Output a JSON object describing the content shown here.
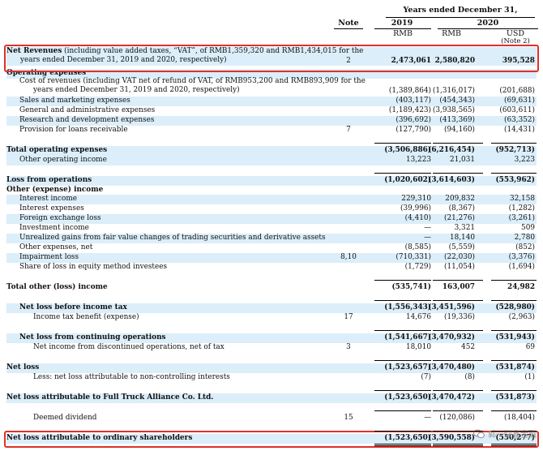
{
  "header": {
    "years_ended": "Years ended December 31,",
    "note": "Note",
    "y2019": "2019",
    "y2020": "2020",
    "rmb1": "RMB",
    "rmb2": "RMB",
    "usd": "USD",
    "note2": "(Note 2)"
  },
  "rows": [
    {
      "label": "Net Revenues (including value added taxes, “VAT”, of RMB1,359,320 and RMB1,434,015 for the",
      "label2": "years ended December 31, 2019 and 2020, respectively)",
      "indent": 0,
      "bold": false,
      "boldlead": "Net Revenues",
      "note": "2",
      "v2019": "2,473,061",
      "v2020": "2,580,820",
      "usd": "395,528",
      "bvals": true,
      "shade": true
    },
    {
      "label": "Operating expenses",
      "indent": 0,
      "bold": true,
      "shade": true
    },
    {
      "label": "Cost of revenues (including VAT net of refund of VAT, of RMB953,200 and RMB893,909 for the",
      "label2": "years ended December 31, 2019 and 2020, respectively)",
      "indent": 1,
      "bold": false,
      "v2019": "(1,389,864)",
      "v2020": "(1,316,017)",
      "usd": "(201,688)",
      "shade": false
    },
    {
      "label": "Sales and marketing expenses",
      "indent": 1,
      "v2019": "(403,117)",
      "v2020": "(454,343)",
      "usd": "(69,631)",
      "shade": true
    },
    {
      "label": "General and administrative expenses",
      "indent": 1,
      "v2019": "(1,189,423)",
      "v2020": "(3,938,565)",
      "usd": "(603,611)",
      "shade": false
    },
    {
      "label": "Research and development expenses",
      "indent": 1,
      "v2019": "(396,692)",
      "v2020": "(413,369)",
      "usd": "(63,352)",
      "shade": true
    },
    {
      "label": "Provision for loans receivable",
      "indent": 1,
      "note": "7",
      "v2019": "(127,790)",
      "v2020": "(94,160)",
      "usd": "(14,431)",
      "shade": false
    },
    {
      "label": "Total operating expenses",
      "indent": 0,
      "bold": true,
      "v2019": "(3,506,886)",
      "v2020": "(6,216,454)",
      "usd": "(952,713)",
      "bvals": true,
      "shade": true
    },
    {
      "label": "Other operating income",
      "indent": 1,
      "v2019": "13,223",
      "v2020": "21,031",
      "usd": "3,223",
      "shade": true
    },
    {
      "label": "Loss from operations",
      "indent": 0,
      "bold": true,
      "v2019": "(1,020,602)",
      "v2020": "(3,614,603)",
      "usd": "(553,962)",
      "bvals": true,
      "shade": true
    },
    {
      "label": "Other (expense) income",
      "indent": 0,
      "bold": true,
      "shade": false
    },
    {
      "label": "Interest income",
      "indent": 1,
      "v2019": "229,310",
      "v2020": "209,832",
      "usd": "32,158",
      "shade": true
    },
    {
      "label": "Interest expenses",
      "indent": 1,
      "v2019": "(39,996)",
      "v2020": "(8,367)",
      "usd": "(1,282)",
      "shade": false
    },
    {
      "label": "Foreign exchange loss",
      "indent": 1,
      "v2019": "(4,410)",
      "v2020": "(21,276)",
      "usd": "(3,261)",
      "shade": true
    },
    {
      "label": "Investment income",
      "indent": 1,
      "v2019": "—",
      "v2020": "3,321",
      "usd": "509",
      "shade": false
    },
    {
      "label": "Unrealized gains from fair value changes of trading securities and derivative assets",
      "indent": 1,
      "v2019": "—",
      "v2020": "18,140",
      "usd": "2,780",
      "shade": true
    },
    {
      "label": "Other expenses, net",
      "indent": 1,
      "v2019": "(8,585)",
      "v2020": "(5,559)",
      "usd": "(852)",
      "shade": false
    },
    {
      "label": "Impairment loss",
      "indent": 1,
      "note": "8,10",
      "v2019": "(710,331)",
      "v2020": "(22,030)",
      "usd": "(3,376)",
      "shade": true
    },
    {
      "label": "Share of loss in equity method investees",
      "indent": 1,
      "v2019": "(1,729)",
      "v2020": "(11,054)",
      "usd": "(1,694)",
      "shade": false
    },
    {
      "label": "Total other (loss) income",
      "indent": 0,
      "bold": true,
      "v2019": "(535,741)",
      "v2020": "163,007",
      "usd": "24,982",
      "bvals": true,
      "shade": false
    },
    {
      "label": "Net loss before income tax",
      "indent": 2,
      "bold": true,
      "v2019": "(1,556,343)",
      "v2020": "(3,451,596)",
      "usd": "(528,980)",
      "bvals": true,
      "shade": true
    },
    {
      "label": "Income tax benefit (expense)",
      "indent": 3,
      "note": "17",
      "v2019": "14,676",
      "v2020": "(19,336)",
      "usd": "(2,963)",
      "shade": false
    },
    {
      "label": "Net loss from continuing operations",
      "indent": 2,
      "bold": true,
      "v2019": "(1,541,667)",
      "v2020": "(3,470,932)",
      "usd": "(531,943)",
      "bvals": true,
      "shade": true
    },
    {
      "label": "Net income from discontinued operations, net of tax",
      "indent": 3,
      "note": "3",
      "v2019": "18,010",
      "v2020": "452",
      "usd": "69",
      "shade": false
    },
    {
      "label": "Net loss",
      "indent": 0,
      "bold": true,
      "v2019": "(1,523,657)",
      "v2020": "(3,470,480)",
      "usd": "(531,874)",
      "bvals": true,
      "shade": true
    },
    {
      "label": "Less: net loss attributable to non-controlling interests",
      "indent": 3,
      "v2019": "(7)",
      "v2020": "(8)",
      "usd": "(1)",
      "shade": false
    },
    {
      "label": "Net loss attributable to Full Truck Alliance Co. Ltd.",
      "indent": 0,
      "bold": true,
      "v2019": "(1,523,650)",
      "v2020": "(3,470,472)",
      "usd": "(531,873)",
      "bvals": true,
      "shade": true
    },
    {
      "label": "Deemed dividend",
      "indent": 3,
      "note": "15",
      "v2019": "—",
      "v2020": "(120,086)",
      "usd": "(18,404)",
      "shade": false
    },
    {
      "label": "Net loss attributable to ordinary shareholders",
      "indent": 0,
      "bold": true,
      "v2019": "(1,523,650)",
      "v2020": "(3,590,558)",
      "usd": "(550,277)",
      "bvals": true,
      "shade": true
    }
  ],
  "watermark": {
    "text": "郭一快鑫金融",
    "icon": "wechat-icon"
  },
  "colors": {
    "highlight_box": "#e0302a",
    "row_shade": "#dbeefa"
  }
}
